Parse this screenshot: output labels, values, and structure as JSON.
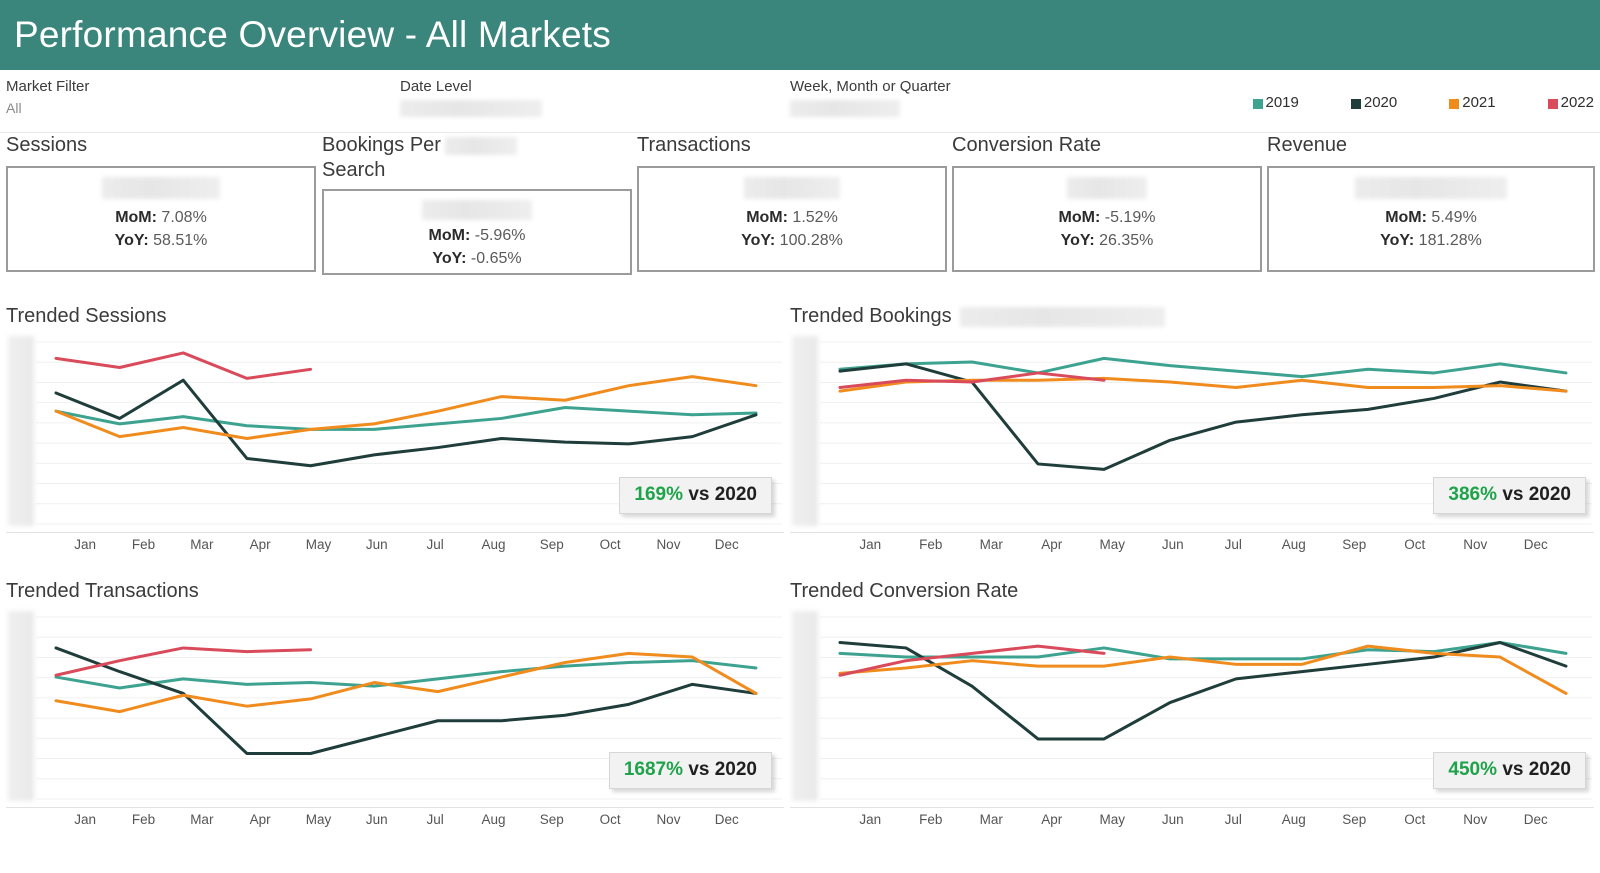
{
  "header": {
    "title": "Performance Overview - All Markets"
  },
  "filters": [
    {
      "label": "Market Filter",
      "value": "All",
      "redacted": false
    },
    {
      "label": "Date Level",
      "value": "",
      "redacted": true
    },
    {
      "label": "Week, Month or Quarter",
      "value": "",
      "redacted": true
    }
  ],
  "legend": {
    "items": [
      {
        "label": "2019",
        "color": "#3DA390"
      },
      {
        "label": "2020",
        "color": "#1F3D3A"
      },
      {
        "label": "2021",
        "color": "#F08C1E"
      },
      {
        "label": "2022",
        "color": "#D94A5A"
      }
    ]
  },
  "kpis": [
    {
      "title": "Sessions",
      "title_redacted": false,
      "mom_label": "MoM:",
      "mom": "7.08%",
      "yoy_label": "YoY:",
      "yoy": "58.51%"
    },
    {
      "title": "Bookings Per Search",
      "title_redacted": true,
      "mom_label": "MoM:",
      "mom": "-5.96%",
      "yoy_label": "YoY:",
      "yoy": "-0.65%"
    },
    {
      "title": "Transactions",
      "title_redacted": false,
      "mom_label": "MoM:",
      "mom": "1.52%",
      "yoy_label": "YoY:",
      "yoy": "100.28%"
    },
    {
      "title": "Conversion Rate",
      "title_redacted": false,
      "mom_label": "MoM:",
      "mom": "-5.19%",
      "yoy_label": "YoY:",
      "yoy": "26.35%"
    },
    {
      "title": "Revenue",
      "title_redacted": false,
      "mom_label": "MoM:",
      "mom": "5.49%",
      "yoy_label": "YoY:",
      "yoy": "181.28%"
    }
  ],
  "charts": [
    {
      "title": "Trended Sessions",
      "title_redacted": false,
      "badge_pct": "169%",
      "badge_suffix": "vs 2020"
    },
    {
      "title": "Trended Bookings",
      "title_redacted": true,
      "badge_pct": "386%",
      "badge_suffix": "vs 2020"
    },
    {
      "title": "Trended Transactions",
      "title_redacted": false,
      "badge_pct": "1687%",
      "badge_suffix": "vs 2020"
    },
    {
      "title": "Trended Conversion Rate",
      "title_redacted": false,
      "badge_pct": "450%",
      "badge_suffix": "vs 2020"
    }
  ],
  "chart_data": [
    {
      "type": "line",
      "title": "Trended Sessions",
      "categories": [
        "Jan",
        "Feb",
        "Mar",
        "Apr",
        "May",
        "Jun",
        "Jul",
        "Aug",
        "Sep",
        "Oct",
        "Nov",
        "Dec"
      ],
      "xlabel": "",
      "ylabel": "",
      "ylim": [
        0,
        100
      ],
      "grid": true,
      "legend_position": "top-right",
      "annotation": "169% vs 2020",
      "series": [
        {
          "name": "2019",
          "color": "#3DA390",
          "values": [
            62,
            55,
            59,
            54,
            52,
            52,
            55,
            58,
            64,
            62,
            60,
            61
          ]
        },
        {
          "name": "2020",
          "color": "#1F3D3A",
          "values": [
            72,
            58,
            79,
            36,
            32,
            38,
            42,
            47,
            45,
            44,
            48,
            60
          ]
        },
        {
          "name": "2021",
          "color": "#F08C1E",
          "values": [
            62,
            48,
            53,
            47,
            52,
            55,
            62,
            70,
            68,
            76,
            81,
            76
          ]
        },
        {
          "name": "2022",
          "color": "#D94A5A",
          "values": [
            91,
            86,
            94,
            80,
            85,
            null,
            null,
            null,
            null,
            null,
            null,
            null
          ]
        }
      ]
    },
    {
      "type": "line",
      "title": "Trended Bookings",
      "categories": [
        "Jan",
        "Feb",
        "Mar",
        "Apr",
        "May",
        "Jun",
        "Jul",
        "Aug",
        "Sep",
        "Oct",
        "Nov",
        "Dec"
      ],
      "xlabel": "",
      "ylabel": "",
      "ylim": [
        0,
        100
      ],
      "grid": true,
      "legend_position": "top-right",
      "annotation": "386% vs 2020",
      "series": [
        {
          "name": "2019",
          "color": "#3DA390",
          "values": [
            85,
            88,
            89,
            83,
            91,
            87,
            84,
            81,
            85,
            83,
            88,
            83
          ]
        },
        {
          "name": "2020",
          "color": "#1F3D3A",
          "values": [
            84,
            88,
            78,
            33,
            30,
            46,
            56,
            60,
            63,
            69,
            78,
            73
          ]
        },
        {
          "name": "2021",
          "color": "#F08C1E",
          "values": [
            73,
            78,
            79,
            79,
            80,
            78,
            75,
            79,
            75,
            75,
            76,
            73
          ]
        },
        {
          "name": "2022",
          "color": "#D94A5A",
          "values": [
            75,
            79,
            78,
            83,
            79,
            null,
            null,
            null,
            null,
            null,
            null,
            null
          ]
        }
      ]
    },
    {
      "type": "line",
      "title": "Trended Transactions",
      "categories": [
        "Jan",
        "Feb",
        "Mar",
        "Apr",
        "May",
        "Jun",
        "Jul",
        "Aug",
        "Sep",
        "Oct",
        "Nov",
        "Dec"
      ],
      "xlabel": "",
      "ylabel": "",
      "ylim": [
        0,
        100
      ],
      "grid": true,
      "legend_position": "top-right",
      "annotation": "1687% vs 2020",
      "series": [
        {
          "name": "2019",
          "color": "#3DA390",
          "values": [
            67,
            61,
            66,
            63,
            64,
            62,
            66,
            70,
            73,
            75,
            76,
            72
          ]
        },
        {
          "name": "2020",
          "color": "#1F3D3A",
          "values": [
            83,
            70,
            58,
            25,
            25,
            34,
            43,
            43,
            46,
            52,
            63,
            58
          ]
        },
        {
          "name": "2021",
          "color": "#F08C1E",
          "values": [
            54,
            48,
            57,
            51,
            55,
            64,
            59,
            67,
            75,
            80,
            78,
            58
          ]
        },
        {
          "name": "2022",
          "color": "#D94A5A",
          "values": [
            68,
            76,
            83,
            81,
            82,
            null,
            null,
            null,
            null,
            null,
            null,
            null
          ]
        }
      ]
    },
    {
      "type": "line",
      "title": "Trended Conversion Rate",
      "categories": [
        "Jan",
        "Feb",
        "Mar",
        "Apr",
        "May",
        "Jun",
        "Jul",
        "Aug",
        "Sep",
        "Oct",
        "Nov",
        "Dec"
      ],
      "xlabel": "",
      "ylabel": "",
      "ylim": [
        0,
        100
      ],
      "grid": true,
      "legend_position": "top-right",
      "annotation": "450% vs 2020",
      "series": [
        {
          "name": "2019",
          "color": "#3DA390",
          "values": [
            80,
            78,
            78,
            78,
            83,
            77,
            77,
            77,
            82,
            81,
            86,
            80
          ]
        },
        {
          "name": "2020",
          "color": "#1F3D3A",
          "values": [
            86,
            83,
            62,
            33,
            33,
            53,
            66,
            70,
            74,
            78,
            86,
            73
          ]
        },
        {
          "name": "2021",
          "color": "#F08C1E",
          "values": [
            69,
            72,
            76,
            73,
            73,
            78,
            74,
            74,
            84,
            80,
            78,
            58
          ]
        },
        {
          "name": "2022",
          "color": "#D94A5A",
          "values": [
            68,
            76,
            80,
            84,
            80,
            null,
            null,
            null,
            null,
            null,
            null,
            null
          ]
        }
      ]
    }
  ]
}
